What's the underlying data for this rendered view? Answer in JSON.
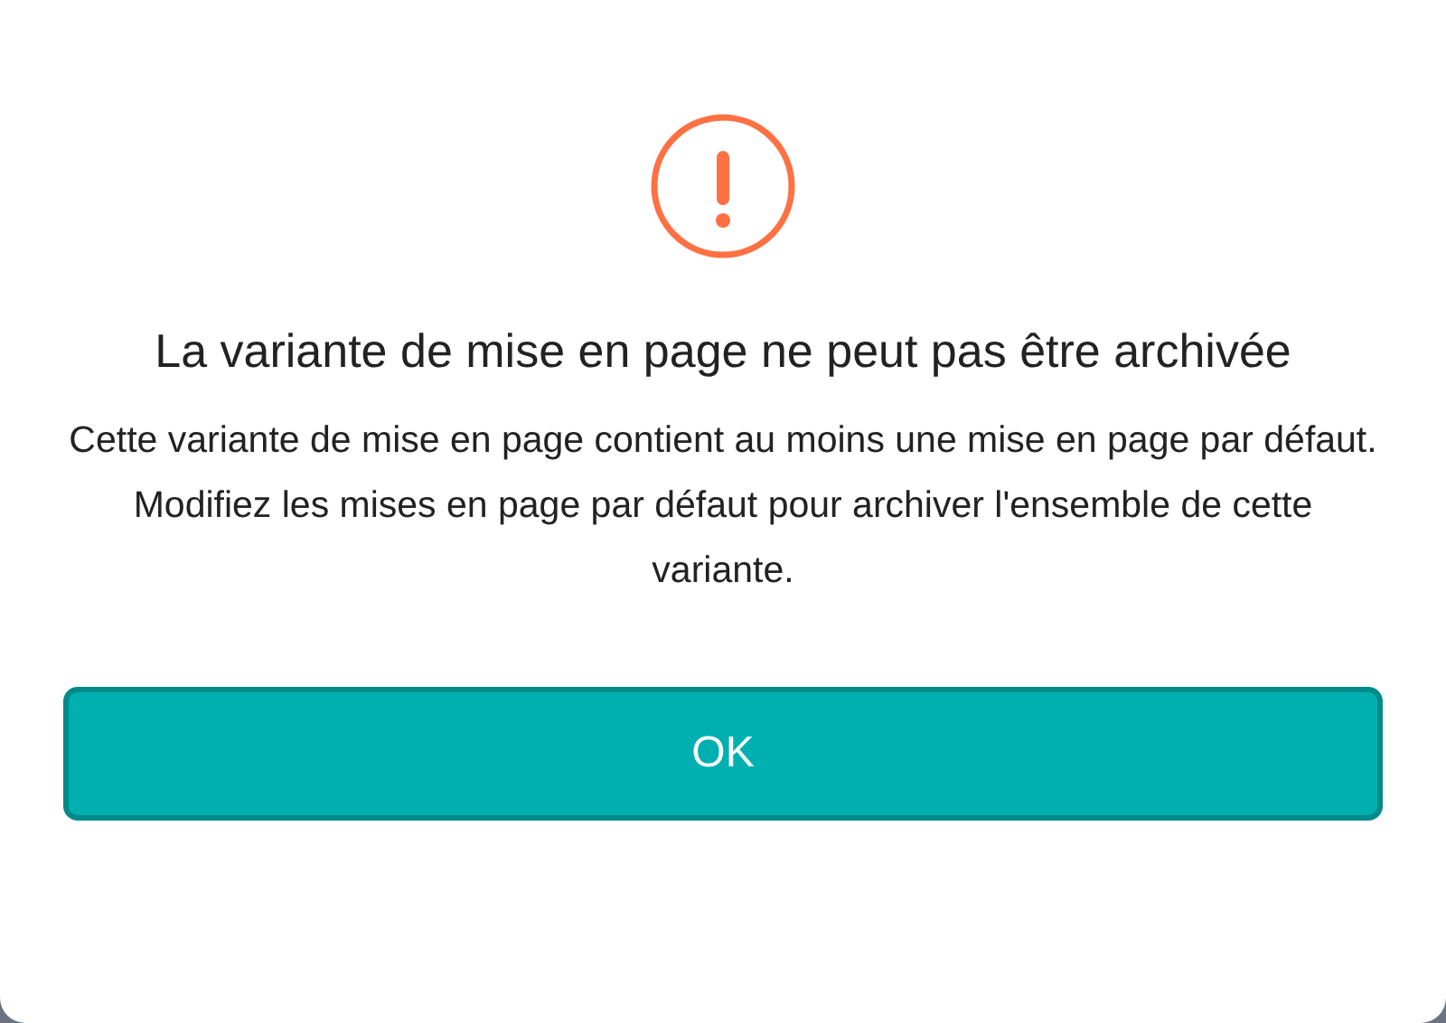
{
  "dialog": {
    "title": "La variante de mise en page ne peut pas être archivée",
    "message": "Cette variante de mise en page contient au moins une mise en page par défaut. Modifiez les mises en page par défaut pour archiver l'ensemble de cette variante.",
    "buttons": [
      "OK"
    ]
  }
}
